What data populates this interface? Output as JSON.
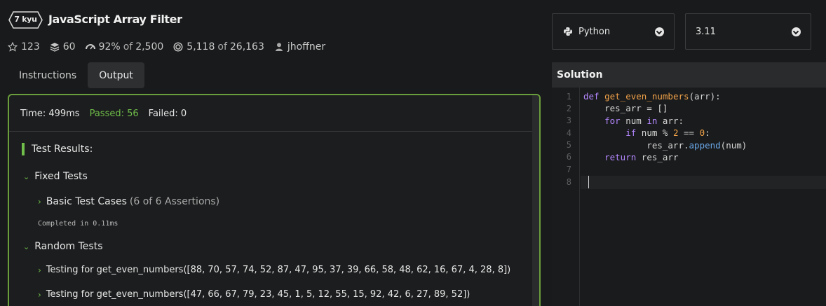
{
  "kata": {
    "rank": "7 kyu",
    "title": "JavaScript Array Filter"
  },
  "stats": {
    "stars": "123",
    "collections": "60",
    "satisfaction": "92%",
    "satisfaction_of": "of",
    "satisfaction_total": "2,500",
    "completed": "5,118",
    "completed_of": "of",
    "completed_total": "26,163",
    "author": "jhoffner"
  },
  "tabs": [
    {
      "label": "Instructions",
      "active": false
    },
    {
      "label": "Output",
      "active": true
    }
  ],
  "output": {
    "time": "Time: 499ms",
    "passed": "Passed: 56",
    "failed": "Failed: 0",
    "results_title": "Test Results:",
    "fixed_tests": "Fixed Tests",
    "basic_cases": "Basic Test Cases",
    "basic_assertions": "(6 of 6 Assertions)",
    "completed_in": "Completed in 0.11ms",
    "random_tests": "Random Tests",
    "random_1": "Testing for get_even_numbers([88, 70, 57, 74, 52, 87, 47, 95, 37, 39, 66, 58, 48, 62, 16, 67, 4, 28, 8])",
    "random_2": "Testing for get_even_numbers([47, 66, 67, 79, 23, 45, 1, 5, 12, 55, 15, 92, 42, 6, 27, 89, 52])"
  },
  "language_select": {
    "value": "Python",
    "icon": "python-icon"
  },
  "version_select": {
    "value": "3.11"
  },
  "solution": {
    "title": "Solution",
    "line_numbers": [
      "1",
      "2",
      "3",
      "4",
      "5",
      "6",
      "7",
      "8"
    ],
    "code": {
      "l1_kw": "def ",
      "l1_fn": "get_even_numbers",
      "l1_rest": "(arr):",
      "l2": "    res_arr = []",
      "l3_kw": "    for",
      "l3_a": " num ",
      "l3_in": "in",
      "l3_b": " arr:",
      "l4_kw": "        if",
      "l4_a": " num % ",
      "l4_n1": "2",
      "l4_b": " == ",
      "l4_n2": "0",
      "l4_c": ":",
      "l5_a": "            res_arr.",
      "l5_m": "append",
      "l5_b": "(num)",
      "l6_kw": "    return",
      "l6_a": " res_arr"
    }
  },
  "colors": {
    "accent_green": "#6fbf4a",
    "panel_border": "#6a9e3c",
    "keyword": "#b388ff",
    "function": "#f0a24a"
  }
}
